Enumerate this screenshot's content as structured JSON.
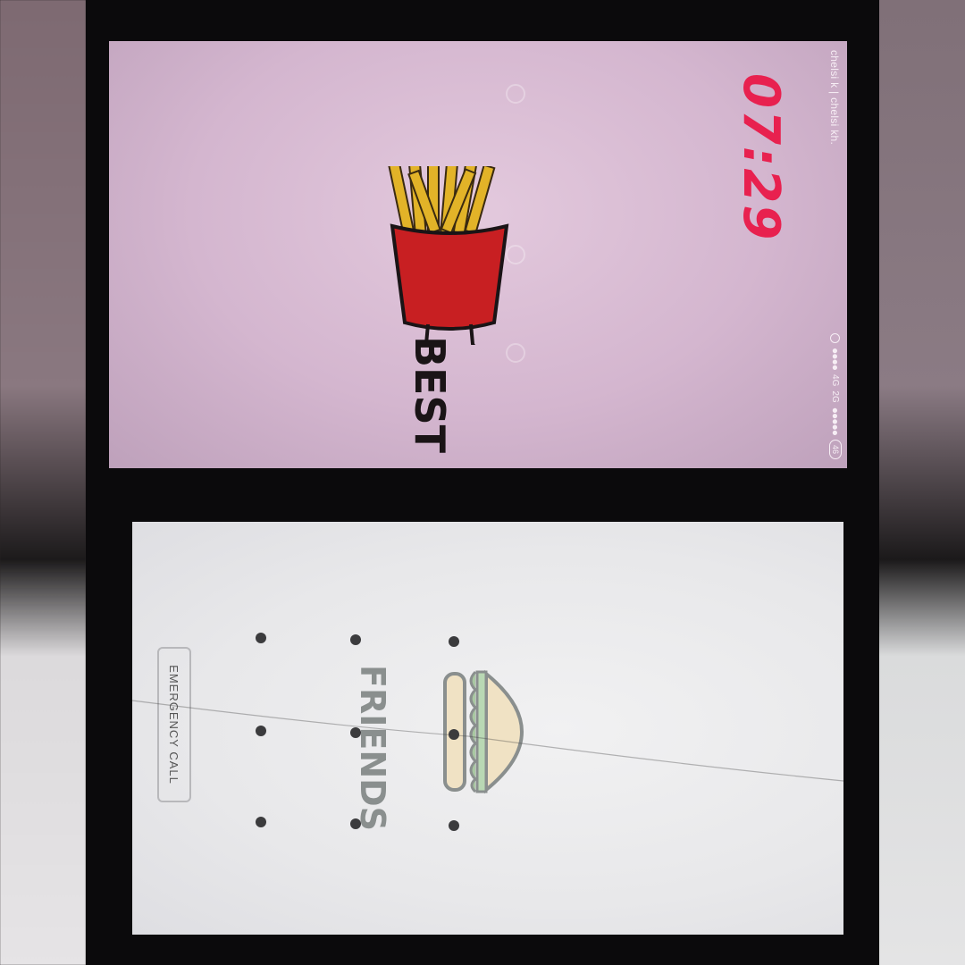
{
  "top_screen": {
    "status_bar": {
      "carrier_text": "chelsi k | chelsi kh.",
      "network_1": "4G",
      "network_2": "2G",
      "battery": "46"
    },
    "clock": {
      "time": "07:29"
    },
    "art": {
      "word": "BEST"
    }
  },
  "bottom_screen": {
    "emergency_label": "EMERGENCY CALL",
    "art": {
      "word": "FRIENDS"
    },
    "pattern_dots": 9
  },
  "colors": {
    "clock": "#e8214f",
    "top_bg": "#d4b6cf",
    "bottom_bg": "#e8e8ea",
    "fries_box": "#c81f22",
    "fries": "#e2b328"
  },
  "icons": [
    "alarm-icon",
    "battery-icon",
    "sun-icon",
    "phone-icon",
    "chat-icon",
    "camera-icon"
  ]
}
